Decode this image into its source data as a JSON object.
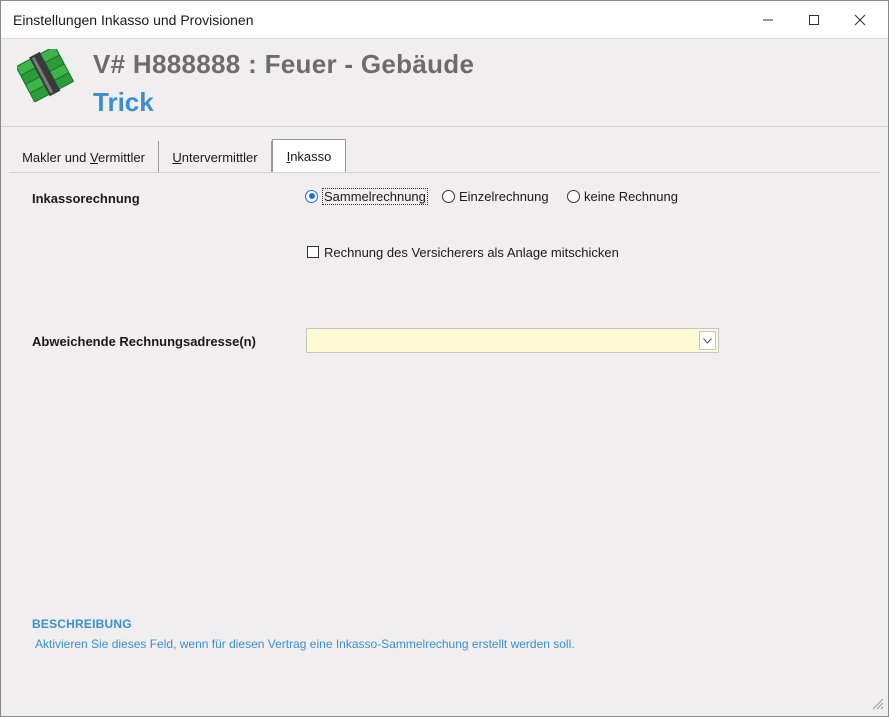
{
  "window": {
    "title": "Einstellungen Inkasso und Provisionen",
    "controls": {
      "minimize": "—",
      "maximize": "☐",
      "close": "✕"
    }
  },
  "header": {
    "logo_icon": "money-stack-icon",
    "contract_title": "V# H888888 : Feuer - Gebäude",
    "client_name": "Trick",
    "colors": {
      "title": "#6c6c6c",
      "client": "#3a8fd0"
    }
  },
  "tabs": [
    {
      "label_pre": "Makler und ",
      "label_u": "V",
      "label_post": "ermittler",
      "active": false
    },
    {
      "label_pre": "",
      "label_u": "U",
      "label_post": "ntervermittler",
      "active": false
    },
    {
      "label_pre": "",
      "label_u": "I",
      "label_post": "nkasso",
      "active": true
    }
  ],
  "form": {
    "inkasso_label": "Inkassorechnung",
    "radio_options": [
      {
        "label": "Sammelrechnung",
        "selected": true
      },
      {
        "label": "Einzelrechnung",
        "selected": false
      },
      {
        "label": "keine Rechnung",
        "selected": false
      }
    ],
    "checkbox_label": "Rechnung des Versicherers als Anlage mitschicken",
    "checkbox_checked": false,
    "address_label": "Abweichende Rechnungsadresse(n)",
    "address_value": "",
    "address_field_color": "#fdfbd3"
  },
  "description": {
    "title": "BESCHREIBUNG",
    "text": "Aktivieren Sie dieses Feld, wenn für diesen Vertrag eine Inkasso-Sammelrechung erstellt werden soll."
  }
}
